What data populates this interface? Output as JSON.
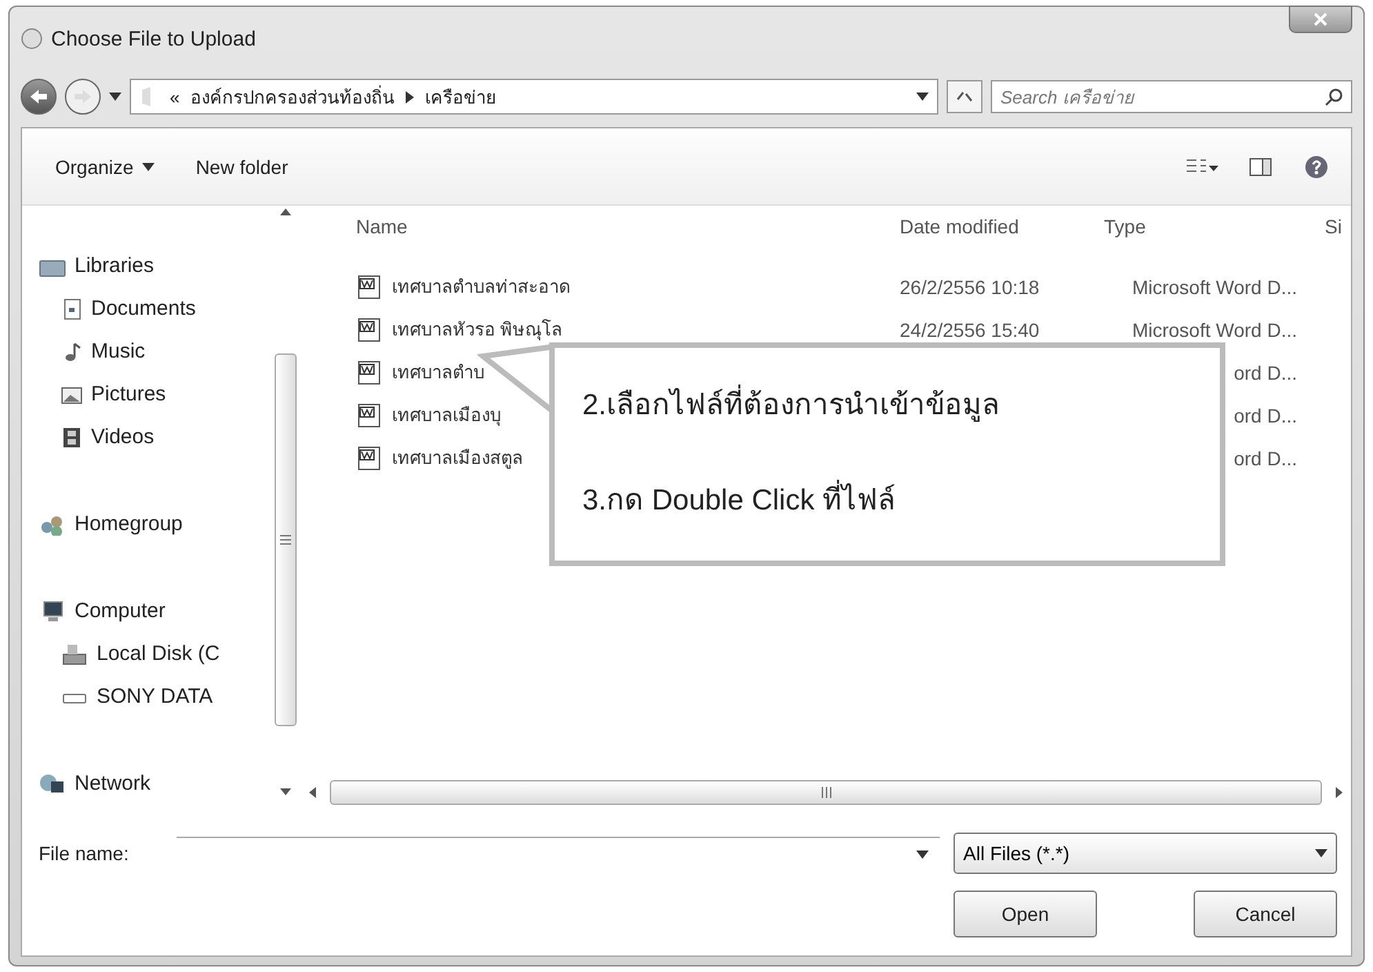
{
  "window": {
    "title": "Choose File to Upload"
  },
  "address_bar": {
    "prefix": "«",
    "path": [
      "องค์กรปกครองส่วนท้องถิ่น",
      "เครือข่าย"
    ]
  },
  "search": {
    "placeholder": "Search เครือข่าย"
  },
  "toolbar": {
    "items": [
      "Organize",
      "New folder"
    ]
  },
  "sidebar": {
    "items": [
      {
        "label": "Libraries",
        "kind": "library",
        "children": [
          {
            "label": "Documents",
            "kind": "documents"
          },
          {
            "label": "Music",
            "kind": "music"
          },
          {
            "label": "Pictures",
            "kind": "pictures"
          },
          {
            "label": "Videos",
            "kind": "videos"
          }
        ]
      },
      {
        "label": "Homegroup",
        "kind": "homegroup"
      },
      {
        "label": "Computer",
        "kind": "computer",
        "children": [
          {
            "label": "Local Disk (C",
            "kind": "disk"
          },
          {
            "label": "SONY DATA",
            "kind": "drive"
          }
        ]
      },
      {
        "label": "Network",
        "kind": "network"
      }
    ]
  },
  "file_list": {
    "columns": [
      "Name",
      "Date modified",
      "Type",
      "Si"
    ],
    "rows": [
      {
        "name": "เทศบาลตำบลท่าสะอาด",
        "date": "26/2/2556 10:18",
        "type": "Microsoft Word D..."
      },
      {
        "name": "เทศบาลหัวรอ พิษณุโล",
        "date": "24/2/2556 15:40",
        "type": "Microsoft Word D..."
      },
      {
        "name": "เทศบาลตำบ",
        "type": "ord D..."
      },
      {
        "name": "เทศบาลเมืองบุ",
        "type": "ord D..."
      },
      {
        "name": "เทศบาลเมืองสตูล",
        "type": "ord D..."
      }
    ]
  },
  "callout": {
    "lines": [
      "2.เลือกไฟล์ที่ต้องการนำเข้าข้อมูล",
      "3.กด Double Click ที่ไฟล์"
    ]
  },
  "footer": {
    "file_name_label": "File name:",
    "file_type": "All Files (*.*)",
    "buttons": [
      "Open",
      "Cancel"
    ]
  }
}
